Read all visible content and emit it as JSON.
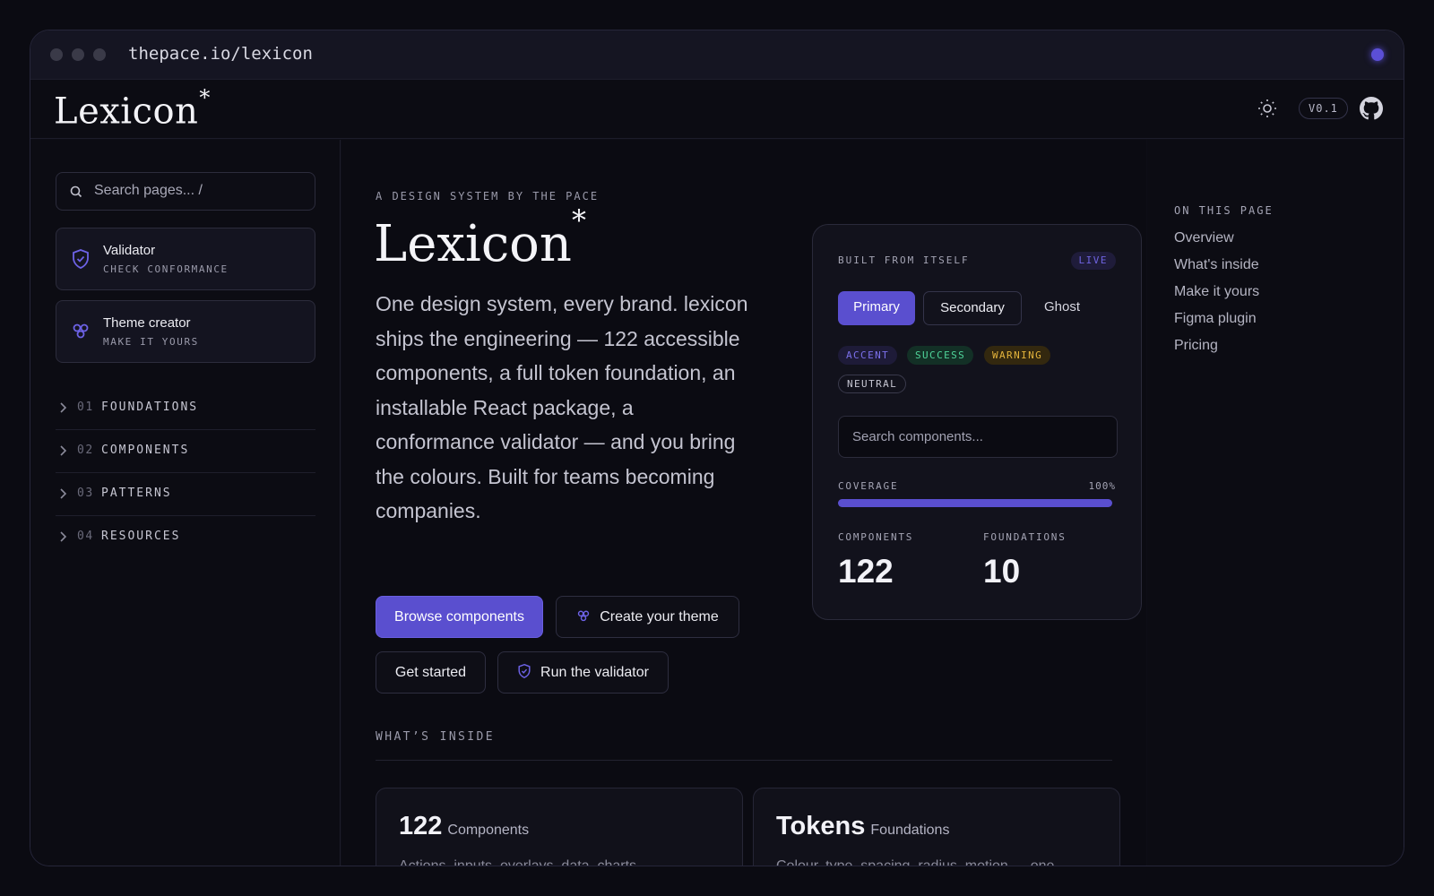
{
  "browser": {
    "url": "thepace.io/lexicon"
  },
  "header": {
    "logo": "Lexicon",
    "logo_mark": "*",
    "version": "V0.1",
    "theme_icon": "sun-icon",
    "repo_icon": "github-icon"
  },
  "sidebar": {
    "search_placeholder": "Search pages...  /",
    "cards": [
      {
        "title": "Validator",
        "subtitle": "CHECK CONFORMANCE",
        "icon": "shield-check-icon"
      },
      {
        "title": "Theme creator",
        "subtitle": "MAKE IT YOURS",
        "icon": "palette-icon"
      }
    ],
    "sections": [
      {
        "num": "01",
        "label": "FOUNDATIONS"
      },
      {
        "num": "02",
        "label": "COMPONENTS"
      },
      {
        "num": "03",
        "label": "PATTERNS"
      },
      {
        "num": "04",
        "label": "RESOURCES"
      }
    ]
  },
  "hero": {
    "eyebrow": "A DESIGN SYSTEM BY THE PACE",
    "title": "Lexicon",
    "title_mark": "*",
    "description": "One design system, every brand. lexicon ships the engineering — 122 accessible components, a full token foundation, an installable React package, a conformance validator — and you bring the colours. Built for teams becoming companies.",
    "buttons": {
      "browse": "Browse components",
      "create_theme": "Create your theme",
      "get_started": "Get started",
      "run_validator": "Run the validator"
    }
  },
  "preview": {
    "label": "BUILT FROM ITSELF",
    "badge": "LIVE",
    "segments": [
      "Primary",
      "Secondary",
      "Ghost"
    ],
    "chips": [
      {
        "label": "ACCENT",
        "color": "#7b70ea"
      },
      {
        "label": "SUCCESS",
        "color": "#4fd49a"
      },
      {
        "label": "WARNING",
        "color": "#e3b33c"
      },
      {
        "label": "NEUTRAL",
        "color": "#c6c6d2"
      }
    ],
    "search_placeholder": "Search components...",
    "coverage_label": "COVERAGE",
    "coverage_value": "100%",
    "coverage_fraction": 1.0,
    "stats": [
      {
        "label": "COMPONENTS",
        "value": "122"
      },
      {
        "label": "FOUNDATIONS",
        "value": "10"
      }
    ]
  },
  "inside": {
    "label": "WHAT’S INSIDE",
    "cards": [
      {
        "big": "122",
        "small": "Components",
        "desc": "Actions, inputs, overlays, data, charts —"
      },
      {
        "big": "Tokens",
        "small": "Foundations",
        "desc": "Colour, type, spacing, radius, motion — one"
      }
    ]
  },
  "toc": {
    "heading": "ON THIS PAGE",
    "items": [
      "Overview",
      "What's inside",
      "Make it yours",
      "Figma plugin",
      "Pricing"
    ]
  },
  "colors": {
    "accent": "#5a4fcf",
    "background": "#0b0b12",
    "surface": "#12121c"
  }
}
